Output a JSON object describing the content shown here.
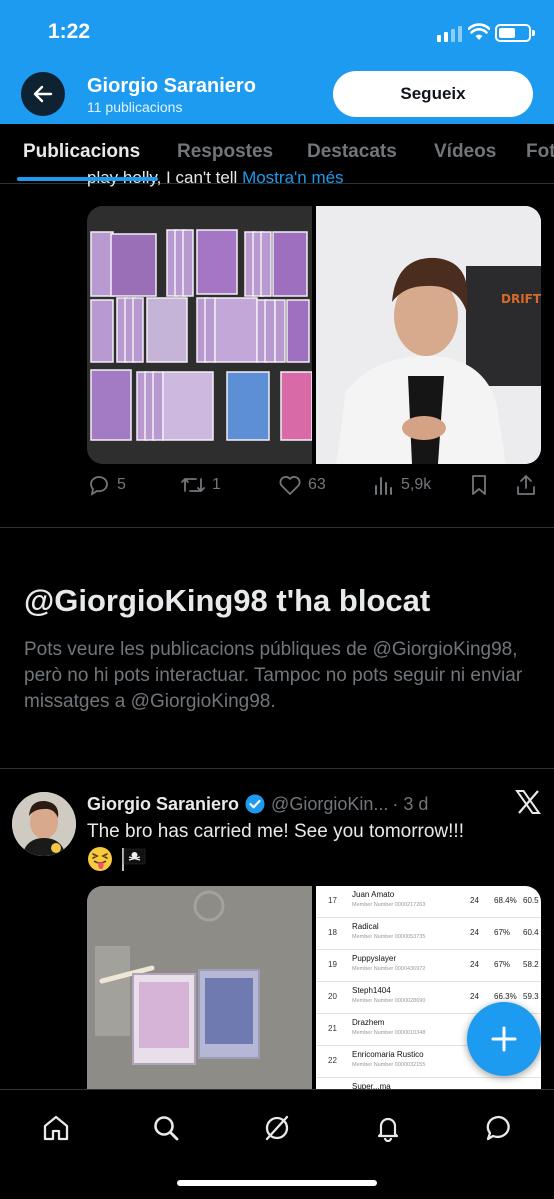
{
  "status_bar": {
    "time": "1:22"
  },
  "header": {
    "name": "Giorgio Saraniero",
    "subtitle": "11 publicacions",
    "follow_label": "Segueix"
  },
  "tabs": [
    {
      "label": "Publicacions",
      "active": true
    },
    {
      "label": "Respostes",
      "active": false
    },
    {
      "label": "Destacats",
      "active": false
    },
    {
      "label": "Vídeos",
      "active": false
    },
    {
      "label": "Fot",
      "active": false
    }
  ],
  "post1": {
    "clipped_text": "play holly, I can't tell ",
    "show_more": "Mostra'n més",
    "replies": "5",
    "reposts": "1",
    "likes": "63",
    "views": "5,9k"
  },
  "blocked": {
    "title": "@GiorgioKing98 t'ha blocat",
    "body": "Pots veure les publicacions públiques de @GiorgioKing98, però no hi pots interactuar. Tampoc no pots seguir ni enviar missatges a @GiorgioKing98."
  },
  "post2": {
    "name": "Giorgio Saraniero",
    "handle": "@GiorgioKin...",
    "time": "· 3 d",
    "text": "The bro has carried me! See you tomorrow!!!",
    "emojis": [
      "😝",
      "🏴‍☠️"
    ],
    "table_rows": [
      {
        "rank": "17",
        "name": "Juan Amato",
        "member": "Member Number 0000217263",
        "c1": "24",
        "c2": "68.4%",
        "c3": "60.5"
      },
      {
        "rank": "18",
        "name": "Radical",
        "member": "Member Number 0000053735",
        "c1": "24",
        "c2": "67%",
        "c3": "60.4"
      },
      {
        "rank": "19",
        "name": "Puppyslayer",
        "member": "Member Number 0000436972",
        "c1": "24",
        "c2": "67%",
        "c3": "58.2"
      },
      {
        "rank": "20",
        "name": "Steph1404",
        "member": "Member Number 0000028690",
        "c1": "24",
        "c2": "66.3%",
        "c3": "59.3"
      },
      {
        "rank": "21",
        "name": "Drazhem",
        "member": "Member Number 0000010348",
        "c1": "",
        "c2": "",
        "c3": ""
      },
      {
        "rank": "22",
        "name": "Enricomaria Rustico",
        "member": "Member Number 0000032155",
        "c1": "",
        "c2": "",
        "c3": ""
      },
      {
        "rank": "",
        "name": "Super...ma",
        "member": "",
        "c1": "",
        "c2": "",
        "c3": ""
      }
    ]
  },
  "colors": {
    "accent": "#1d9bf0",
    "background": "#000000",
    "muted": "#71767b"
  },
  "bottom_nav": [
    "home-icon",
    "search-icon",
    "grok-icon",
    "notifications-icon",
    "messages-icon"
  ]
}
